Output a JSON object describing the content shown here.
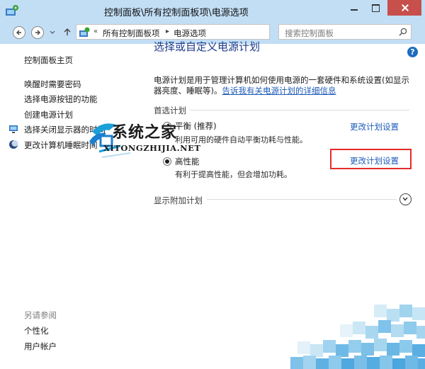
{
  "window": {
    "title": "控制面板\\所有控制面板项\\电源选项"
  },
  "addressbar": {
    "overflow": "«",
    "crumbs": [
      "所有控制面板项",
      "电源选项"
    ],
    "search_placeholder": "搜索控制面板"
  },
  "leftnav": {
    "items": [
      "控制面板主页",
      "唤醒时需要密码",
      "选择电源按钮的功能",
      "创建电源计划",
      "选择关闭显示器的时间",
      "更改计算机睡眠时间"
    ],
    "see_also": "另请参阅",
    "see_also_items": [
      "个性化",
      "用户帐户"
    ]
  },
  "main": {
    "help": "?",
    "heading": "选择或自定义电源计划",
    "description": "电源计划是用于管理计算机如何使用电源的一套硬件和系统设置(如显示器亮度、睡眠等)。",
    "description_link": "告诉我有关电源计划的详细信息",
    "preferred_label": "首选计划",
    "plans": [
      {
        "name": "平衡 (推荐)",
        "desc": "利用可用的硬件自动平衡功耗与性能。",
        "link": "更改计划设置",
        "selected": false
      },
      {
        "name": "高性能",
        "desc": "有利于提高性能，但会增加功耗。",
        "link": "更改计划设置",
        "selected": true
      }
    ],
    "extra_label": "显示附加计划"
  },
  "watermark": {
    "title": "系统之家",
    "subtitle": "XITONGZHIJIA.NET"
  },
  "colors": {
    "titlebar": "#c2def5",
    "link": "#1e5bb8",
    "heading": "#1d3a87",
    "highlight": "#e52b2b",
    "close": "#c7504c"
  }
}
